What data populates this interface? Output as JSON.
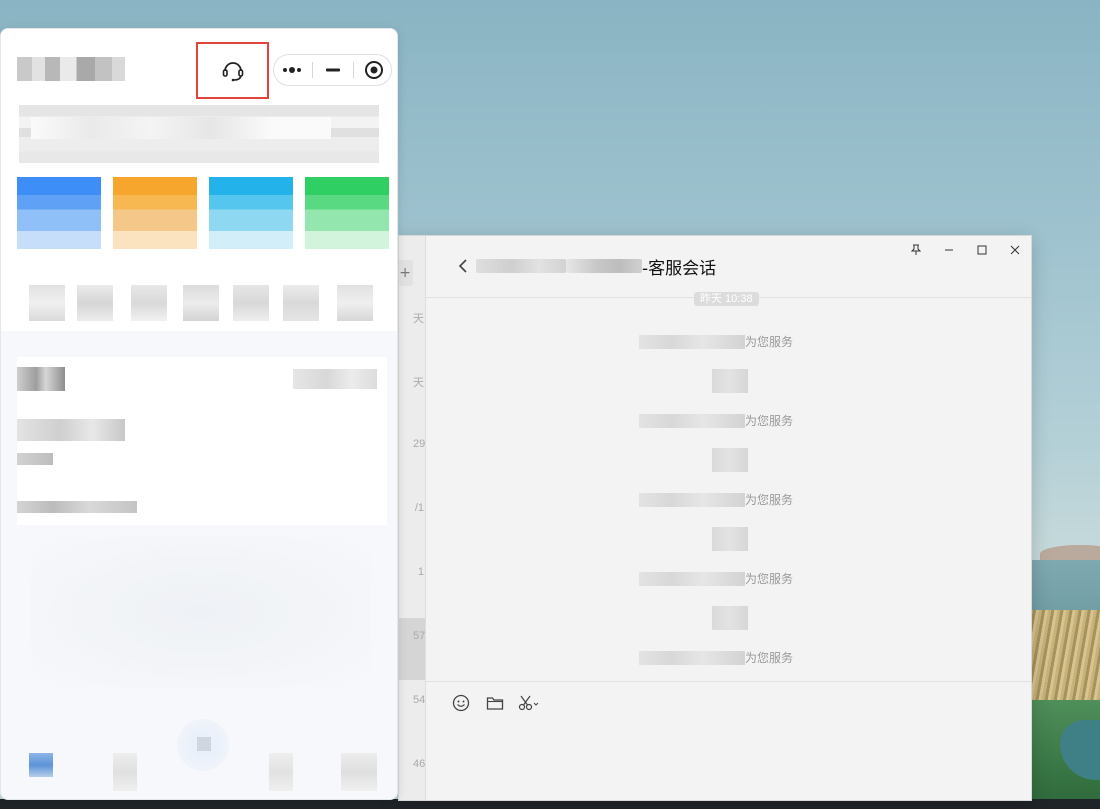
{
  "chat_window": {
    "title_suffix": "-客服会话",
    "date_chip": "昨天 10:38",
    "window_controls": [
      "pin",
      "minimize",
      "maximize",
      "close"
    ],
    "list_stamps": [
      "天",
      "天",
      "29",
      "/1",
      "1",
      "57",
      "54",
      "46"
    ],
    "list_add_icon": "+",
    "messages": [
      {
        "text": "为您服务"
      },
      {
        "text": "为您服务"
      },
      {
        "text": "为您服务"
      },
      {
        "text": "为您服务"
      },
      {
        "text": "为您服务"
      }
    ],
    "toolbar_icons": [
      "emoji-icon",
      "folder-icon",
      "scissors-icon"
    ]
  },
  "panel": {
    "top_right_icons": [
      "customer-service-icon",
      "more-icon",
      "minimize-icon",
      "record-icon"
    ],
    "app_tile_colors": [
      "#2f86f6",
      "#f5a623",
      "#22b3ea",
      "#22c55e"
    ]
  },
  "colors": {
    "highlight_border": "#e0453c",
    "chat_bg": "#f3f3f3"
  }
}
